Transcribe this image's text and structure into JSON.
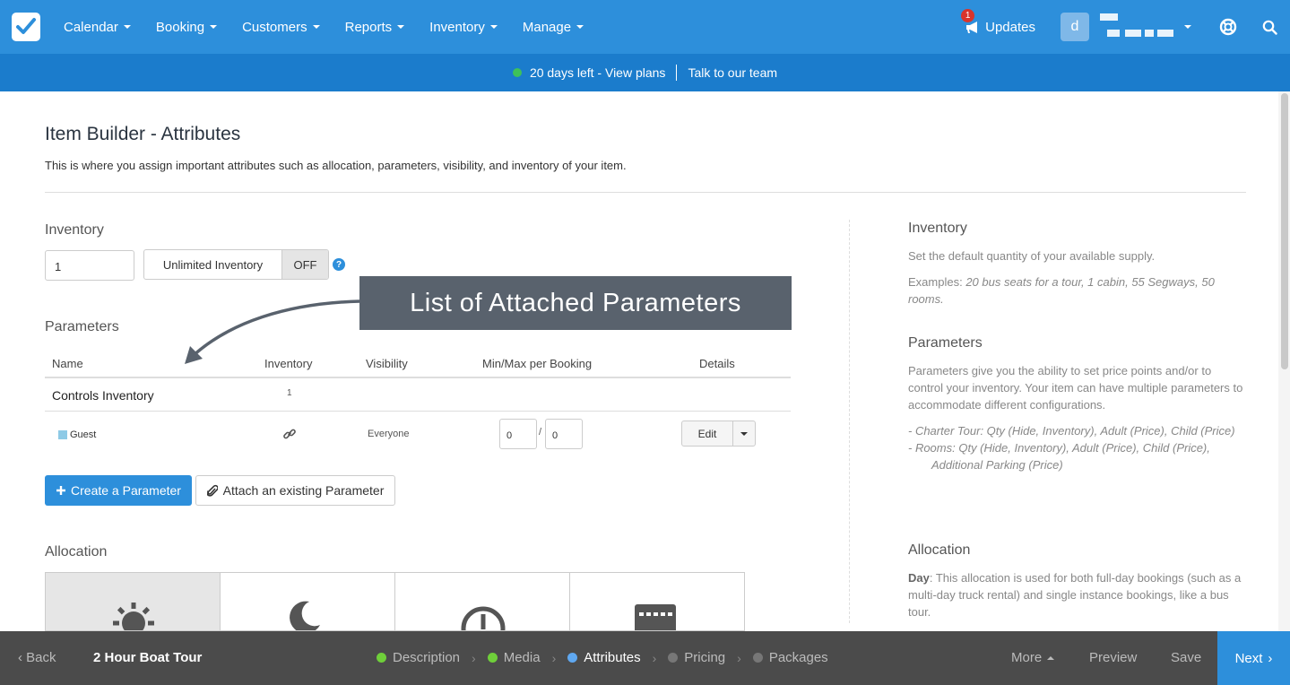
{
  "nav": {
    "items": [
      {
        "label": "Calendar"
      },
      {
        "label": "Booking"
      },
      {
        "label": "Customers"
      },
      {
        "label": "Reports"
      },
      {
        "label": "Inventory"
      },
      {
        "label": "Manage"
      }
    ],
    "updates_label": "Updates",
    "updates_badge": "1",
    "avatar_letter": "d"
  },
  "trial": {
    "days_left": "20 days left - View plans",
    "talk": "Talk to our team"
  },
  "page": {
    "title": "Item Builder - Attributes",
    "subtitle": "This is where you assign important attributes such as allocation, parameters, visibility, and inventory of your item."
  },
  "inventory": {
    "label": "Inventory",
    "value": "1",
    "unlimited_label": "Unlimited Inventory",
    "unlimited_state": "OFF",
    "help": "?"
  },
  "callout": "List of Attached Parameters",
  "parameters": {
    "label": "Parameters",
    "headers": [
      "Name",
      "Inventory",
      "Visibility",
      "Min/Max per Booking",
      "Details"
    ],
    "controls_row": {
      "name": "Controls Inventory",
      "inventory": "1"
    },
    "rows": [
      {
        "name": "Guest",
        "visibility": "Everyone",
        "min": "0",
        "max": "0",
        "sep": "/",
        "details": "Edit",
        "color": "#8ecae6"
      }
    ],
    "create_button": "Create a Parameter",
    "attach_button": "Attach an existing Parameter"
  },
  "allocation": {
    "label": "Allocation"
  },
  "help": {
    "inventory": {
      "title": "Inventory",
      "text": "Set the default quantity of your available supply.",
      "examples_prefix": "Examples: ",
      "examples": "20 bus seats for a tour, 1 cabin, 55 Segways, 50 rooms."
    },
    "parameters": {
      "title": "Parameters",
      "text": "Parameters give you the ability to set price points and/or to control your inventory. Your item can have multiple parameters to accommodate different configurations.",
      "ex1": "- Charter Tour: Qty (Hide, Inventory), Adult (Price), Child (Price)",
      "ex2": "- Rooms: Qty (Hide, Inventory), Adult (Price), Child (Price),",
      "ex2b": "Additional Parking (Price)"
    },
    "allocation": {
      "title": "Allocation",
      "day_label": "Day",
      "text": ": This allocation is used for both full-day bookings (such as a multi-day truck rental) and single instance bookings, like a bus tour."
    }
  },
  "bottom": {
    "back": "Back",
    "item_name": "2 Hour Boat Tour",
    "steps": [
      {
        "label": "Description",
        "color": "#6fcf3a"
      },
      {
        "label": "Media",
        "color": "#6fcf3a"
      },
      {
        "label": "Attributes",
        "color": "#5fa8f0"
      },
      {
        "label": "Pricing",
        "color": "#777777"
      },
      {
        "label": "Packages",
        "color": "#777777"
      }
    ],
    "more": "More",
    "preview": "Preview",
    "save": "Save",
    "next": "Next"
  }
}
